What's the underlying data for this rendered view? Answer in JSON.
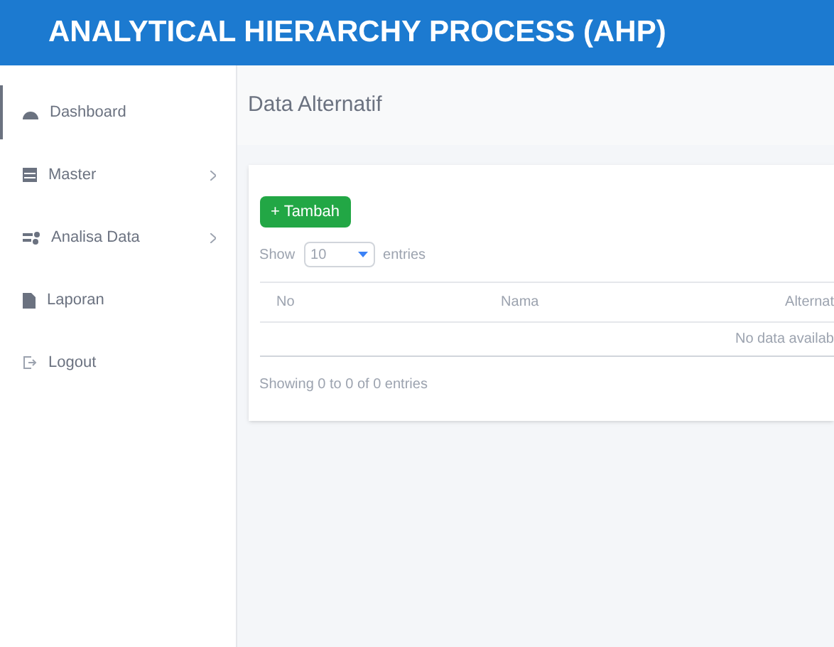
{
  "header": {
    "title": "ANALYTICAL HIERARCHY PROCESS (AHP)"
  },
  "sidebar": {
    "items": [
      {
        "label": "Dashboard",
        "kind": "dashboard",
        "has_submenu": false,
        "selected": true
      },
      {
        "label": "Master",
        "kind": "table",
        "has_submenu": true,
        "selected": false
      },
      {
        "label": "Analisa Data",
        "kind": "share",
        "has_submenu": true,
        "selected": false
      },
      {
        "label": "Laporan",
        "kind": "file",
        "has_submenu": false,
        "selected": false
      },
      {
        "label": "Logout",
        "kind": "logout",
        "has_submenu": false,
        "selected": false
      }
    ]
  },
  "page": {
    "title": "Data Alternatif"
  },
  "card": {
    "add_button": "+ Tambah",
    "show_label": "Show",
    "page_size": "10",
    "entries_label": "entries",
    "table": {
      "columns": [
        "No",
        "Nama",
        "Alternat"
      ],
      "empty_message": "No data availab"
    },
    "info": "Showing 0 to 0 of 0 entries"
  }
}
